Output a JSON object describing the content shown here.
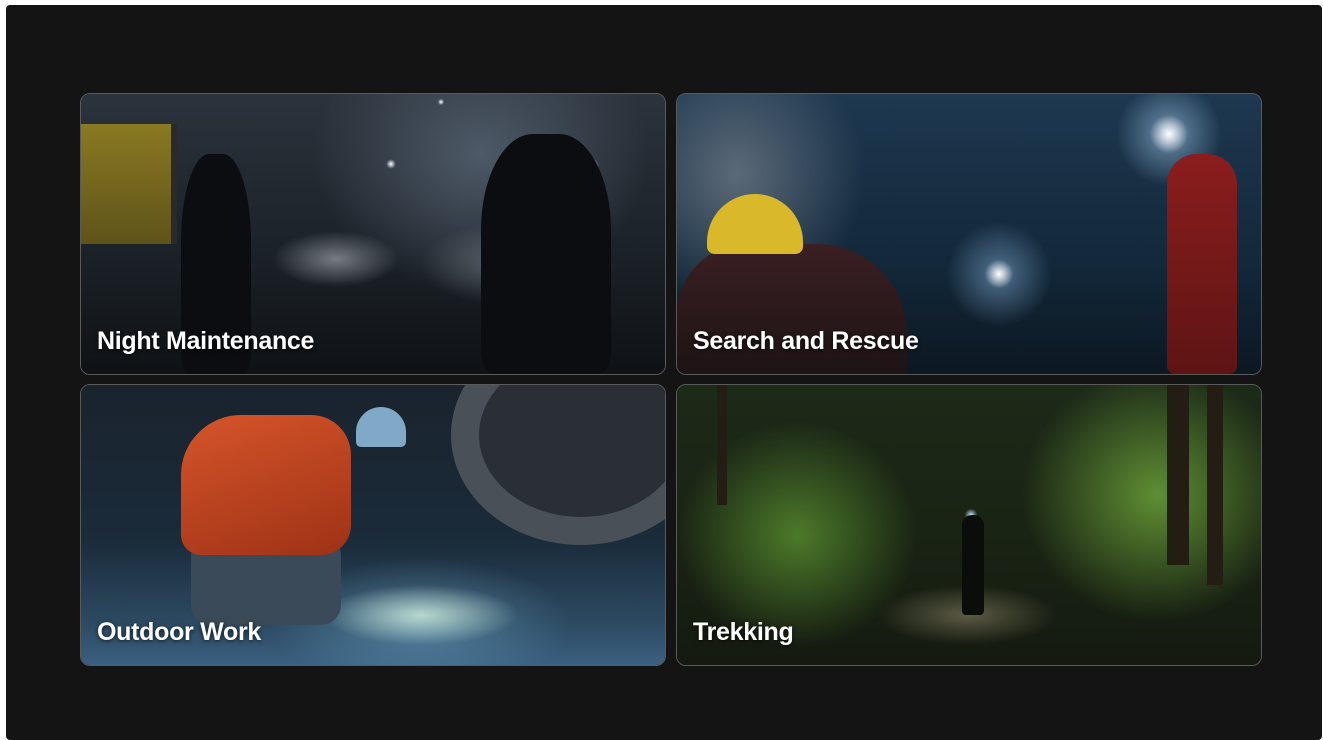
{
  "cards": [
    {
      "title": "Night Maintenance"
    },
    {
      "title": "Search and Rescue"
    },
    {
      "title": "Outdoor Work"
    },
    {
      "title": "Trekking"
    }
  ],
  "colors": {
    "background": "#141414",
    "card_border": "#5a5a5a",
    "title_text": "#ffffff"
  }
}
